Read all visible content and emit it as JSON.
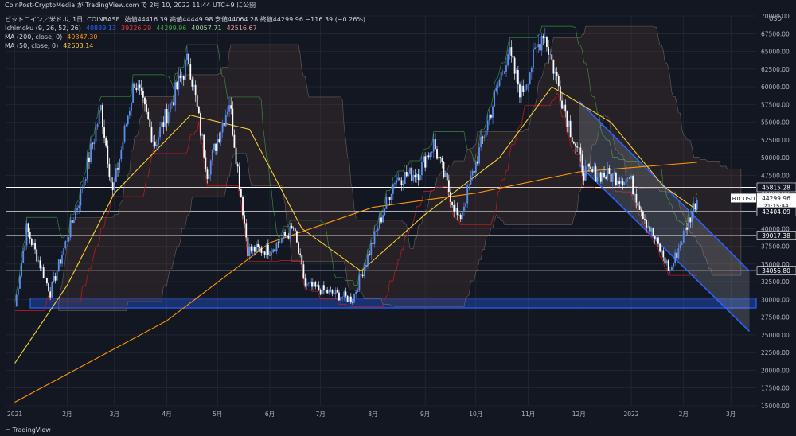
{
  "header": {
    "title": "CoinPost-CryptoMedia が TradingView.com で 2月 10, 2022 11:44 UTC+9 に公開"
  },
  "legend": {
    "line1": "ビットコイン／米ドル, 1日, COINBASE",
    "ohlc": "始値44416.39  高値44449.98  安値44064.28  終値44299.96  −116.39 (−0.26%)",
    "ichimoku_label": "Ichimoku (9, 26, 52, 26)",
    "ichimoku_values": [
      "40889.13",
      "39226.29",
      "44299.96",
      "40057.71",
      "42516.67"
    ],
    "ma200_label": "MA (200, close, 0)",
    "ma200_value": "49347.30",
    "ma50_label": "MA (50, close, 0)",
    "ma50_value": "42603.14"
  },
  "footer": {
    "brand": "TradingView"
  },
  "colors": {
    "background": "#131722",
    "up": "#5b8def",
    "down": "#ffffff",
    "ma200": "#ff9800",
    "ma50": "#f5d033",
    "tenkan": "#2962ff",
    "kijun": "#b71c1c",
    "chikou": "#43a047",
    "channel": "#2962ff"
  },
  "chart_data": {
    "type": "candlestick",
    "symbol": "BTCUSD",
    "y_axis_unit": "USD",
    "ylim": [
      15000,
      70000
    ],
    "y_ticks": [
      15000,
      17500,
      20000,
      22500,
      25000,
      27500,
      30000,
      32500,
      35000,
      37500,
      40000,
      42500,
      45000,
      47500,
      50000,
      52500,
      55000,
      57500,
      60000,
      62500,
      65000,
      67500,
      70000
    ],
    "x_ticks": [
      "2021",
      "2月",
      "3月",
      "4月",
      "5月",
      "6月",
      "7月",
      "8月",
      "9月",
      "10月",
      "11月",
      "12月",
      "2022",
      "2月",
      "3月"
    ],
    "price_path": [
      [
        "2021-01-01",
        29000
      ],
      [
        "2021-01-08",
        40000
      ],
      [
        "2021-01-22",
        31000
      ],
      [
        "2021-02-08",
        44000
      ],
      [
        "2021-02-21",
        57000
      ],
      [
        "2021-02-28",
        45000
      ],
      [
        "2021-03-13",
        61000
      ],
      [
        "2021-03-25",
        52000
      ],
      [
        "2021-04-14",
        64000
      ],
      [
        "2021-04-25",
        48000
      ],
      [
        "2021-05-08",
        58000
      ],
      [
        "2021-05-19",
        37000
      ],
      [
        "2021-06-01",
        37000
      ],
      [
        "2021-06-15",
        40000
      ],
      [
        "2021-06-22",
        32000
      ],
      [
        "2021-07-20",
        30000
      ],
      [
        "2021-08-14",
        47000
      ],
      [
        "2021-08-28",
        48000
      ],
      [
        "2021-09-06",
        52000
      ],
      [
        "2021-09-21",
        41000
      ],
      [
        "2021-10-20",
        65000
      ],
      [
        "2021-10-28",
        59000
      ],
      [
        "2021-11-10",
        68000
      ],
      [
        "2021-11-26",
        54000
      ],
      [
        "2021-12-04",
        48000
      ],
      [
        "2021-12-31",
        47000
      ],
      [
        "2022-01-10",
        41000
      ],
      [
        "2022-01-24",
        34000
      ],
      [
        "2022-02-09",
        44299.96
      ]
    ],
    "ma200": [
      [
        "2021-01-01",
        15500
      ],
      [
        "2021-04-01",
        27000
      ],
      [
        "2021-06-01",
        38000
      ],
      [
        "2021-08-01",
        43000
      ],
      [
        "2021-10-01",
        45000
      ],
      [
        "2021-12-01",
        48000
      ],
      [
        "2022-02-09",
        49347.3
      ]
    ],
    "ma50": [
      [
        "2021-01-01",
        21000
      ],
      [
        "2021-02-01",
        32000
      ],
      [
        "2021-03-01",
        45000
      ],
      [
        "2021-04-15",
        56000
      ],
      [
        "2021-05-20",
        54000
      ],
      [
        "2021-06-20",
        40000
      ],
      [
        "2021-07-25",
        34000
      ],
      [
        "2021-09-01",
        42000
      ],
      [
        "2021-10-15",
        50000
      ],
      [
        "2021-11-15",
        60000
      ],
      [
        "2021-12-20",
        55000
      ],
      [
        "2022-01-20",
        46000
      ],
      [
        "2022-02-09",
        42603.14
      ]
    ],
    "horizontal_levels": [
      45815.28,
      42404.09,
      39017.38,
      34056.8
    ],
    "support_zone": [
      28800,
      30200
    ],
    "channel": {
      "upper": [
        [
          "2021-12-01",
          58000
        ],
        [
          "2022-03-12",
          34000
        ]
      ],
      "lower": [
        [
          "2021-12-01",
          49000
        ],
        [
          "2022-03-12",
          25500
        ]
      ]
    },
    "price_tags": [
      {
        "label": "45815.28",
        "value": 45815.28
      },
      {
        "label": "BTCUSD",
        "value": 44299.96,
        "sub": [
          "44299.96",
          "21:15:44"
        ]
      },
      {
        "label": "42404.09",
        "value": 42404.09
      },
      {
        "label": "39017.38",
        "value": 39017.38
      },
      {
        "label": "34056.80",
        "value": 34056.8
      }
    ]
  }
}
